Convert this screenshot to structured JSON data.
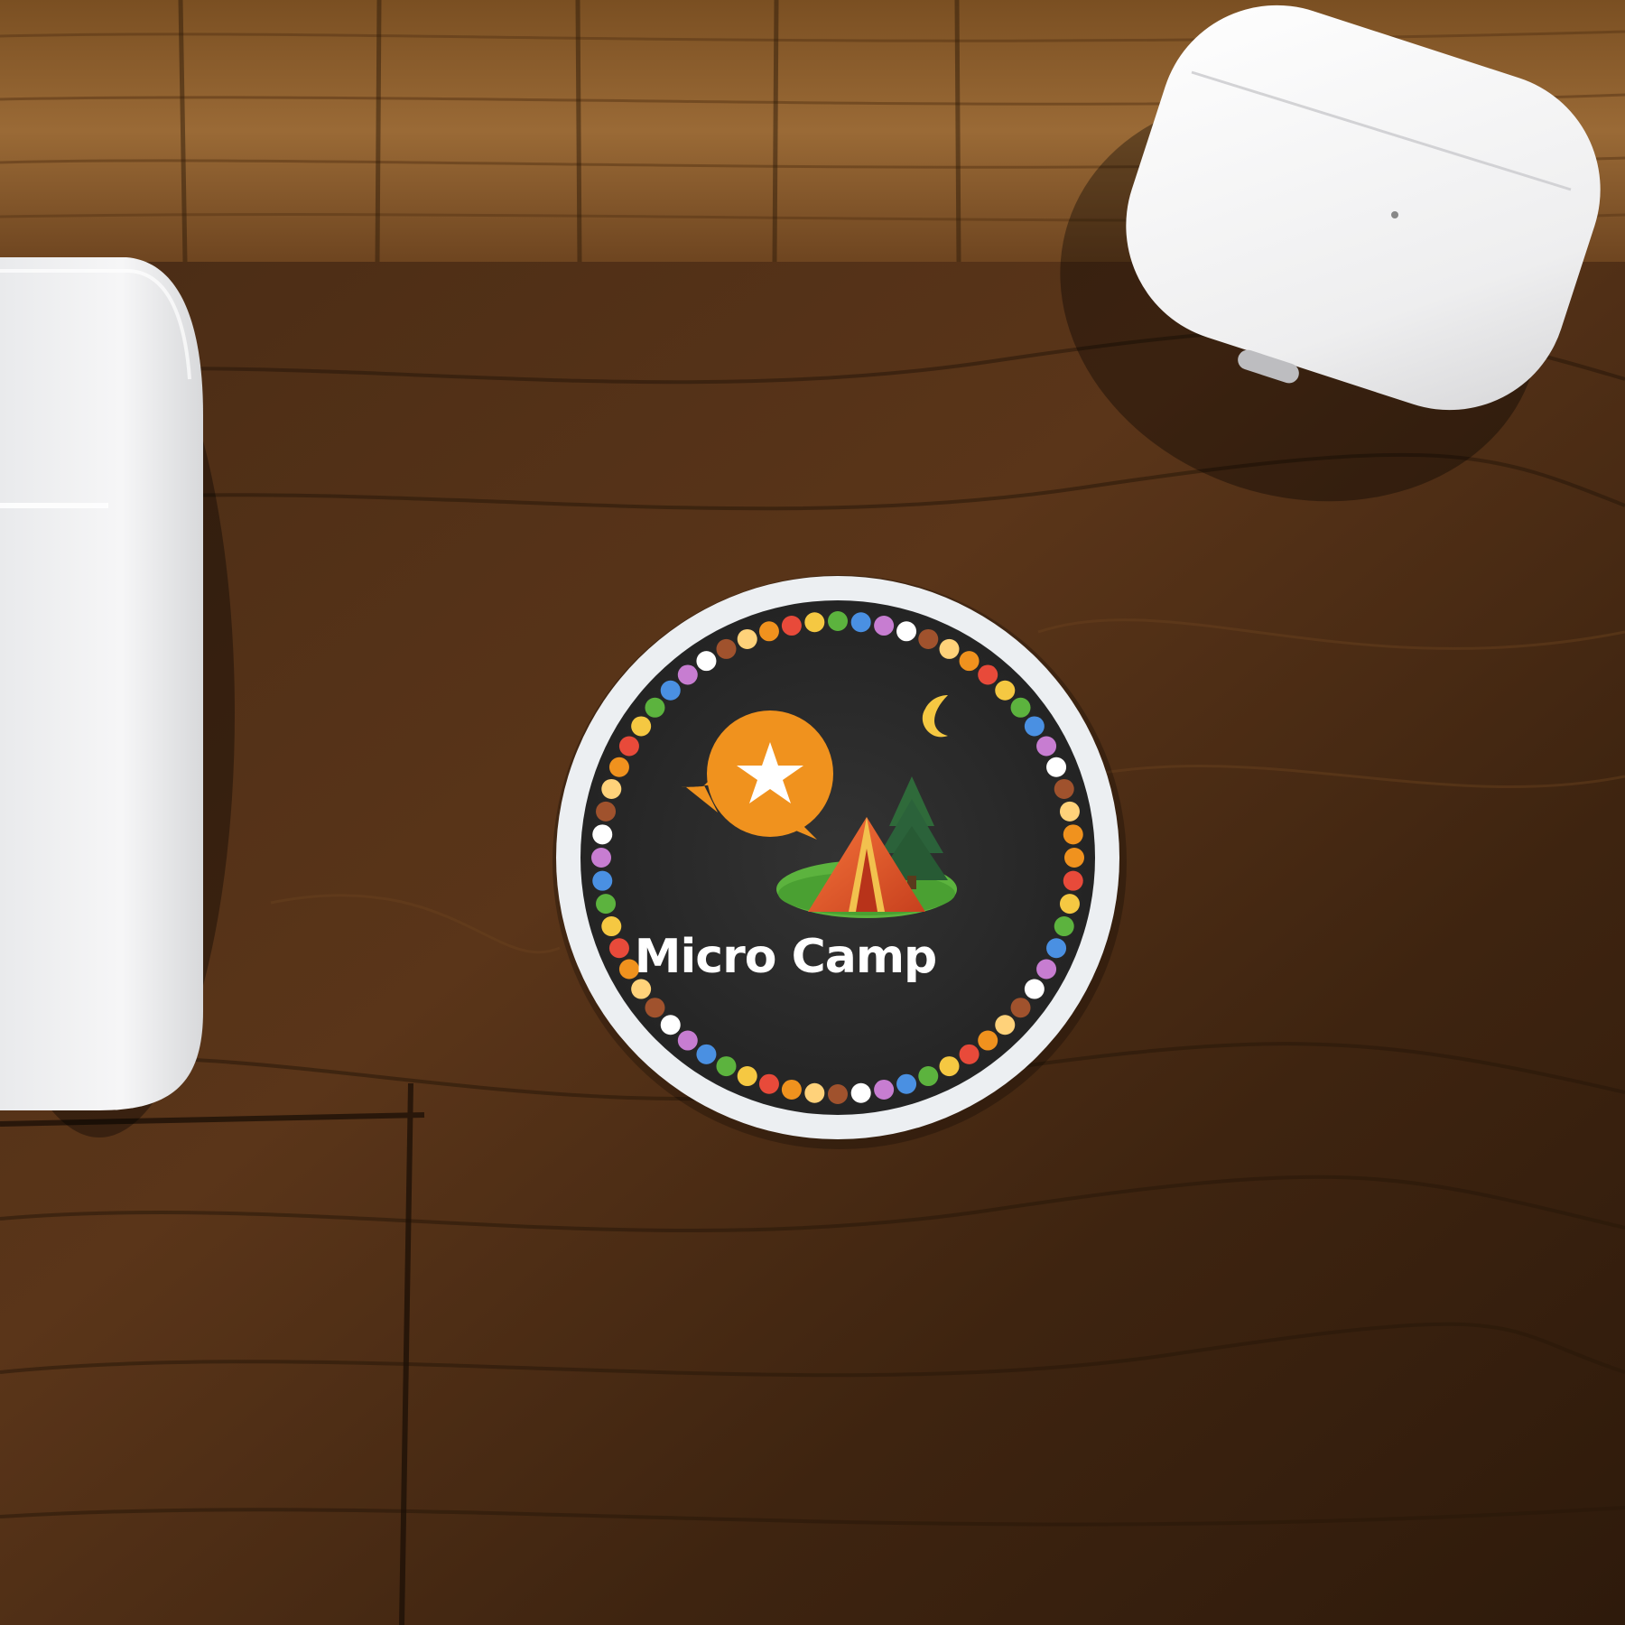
{
  "scene": {
    "description_colors": {
      "desk_light": "#8a5a2c",
      "desk_dark": "#3b2312",
      "sticker_face": "#2b2b2b",
      "sticker_border": "#e9ecef",
      "accent_orange": "#f0921e",
      "tent_orange": "#e8552a",
      "grass": "#5cb33e",
      "tree": "#2f6a3a",
      "moon": "#f5c842"
    }
  },
  "sticker": {
    "title": "Micro Camp",
    "icons": [
      "star-bubble-icon",
      "tent-icon",
      "tree-icon",
      "moon-icon"
    ]
  }
}
